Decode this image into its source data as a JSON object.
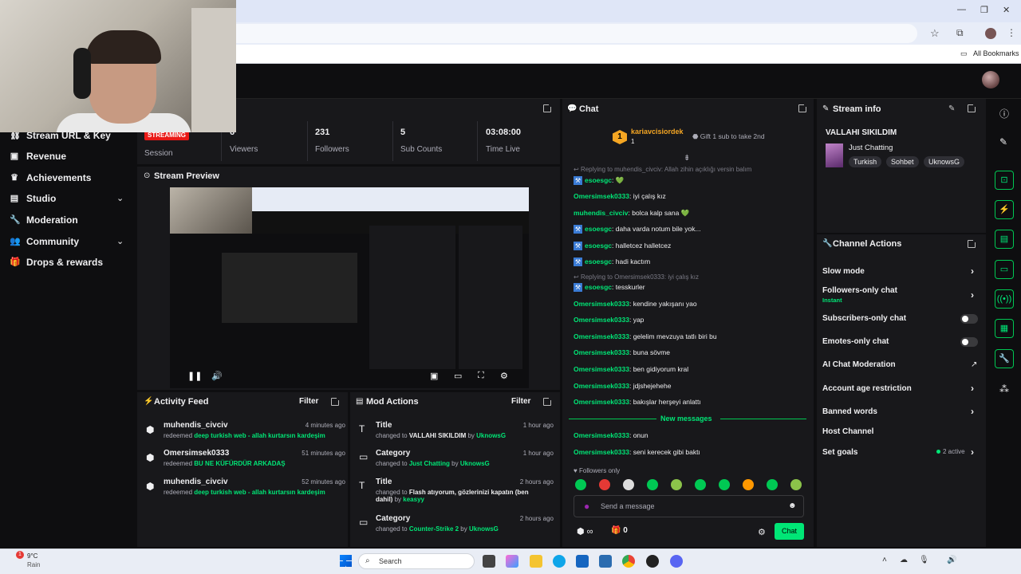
{
  "browser": {
    "bookmarks_label": "All Bookmarks",
    "star_icon": "star-icon",
    "extensions_icon": "puzzle-icon",
    "menu_icon": "kebab-icon"
  },
  "sidebar": {
    "items": [
      {
        "label": "Stream URL & Key",
        "icon": "link-icon"
      },
      {
        "label": "Revenue",
        "icon": "revenue-icon"
      },
      {
        "label": "Achievements",
        "icon": "trophy-icon"
      },
      {
        "label": "Studio",
        "icon": "studio-icon"
      },
      {
        "label": "Moderation",
        "icon": "wrench-icon"
      },
      {
        "label": "Community",
        "icon": "people-icon"
      },
      {
        "label": "Drops & rewards",
        "icon": "gift-icon"
      }
    ]
  },
  "stats": {
    "badge": "STREAMING",
    "session_label": "Session",
    "viewers_value": "6",
    "viewers_label": "Viewers",
    "followers_value": "231",
    "followers_label": "Followers",
    "subs_value": "5",
    "subs_label": "Sub Counts",
    "time_value": "03:08:00",
    "time_label": "Time Live"
  },
  "preview": {
    "title": "Stream Preview"
  },
  "activity": {
    "title": "Activity Feed",
    "filter": "Filter",
    "items": [
      {
        "user": "muhendis_civciv",
        "time": "4 minutes ago",
        "action": "redeemed",
        "reward": "deep turkish web - allah kurtarsın kardeşim"
      },
      {
        "user": "Omersimsek0333",
        "time": "51 minutes ago",
        "action": "redeemed",
        "reward": "BU NE KÜFÜRDÜR ARKADAŞ"
      },
      {
        "user": "muhendis_civciv",
        "time": "52 minutes ago",
        "action": "redeemed",
        "reward": "deep turkish web - allah kurtarsın kardeşim"
      }
    ]
  },
  "mod": {
    "title": "Mod Actions",
    "filter": "Filter",
    "items": [
      {
        "field": "Title",
        "time": "1 hour ago",
        "prefix": "changed to",
        "value": "VALLAHI SIKILDIM",
        "by": "by",
        "user": "UknowsG"
      },
      {
        "field": "Category",
        "time": "1 hour ago",
        "prefix": "changed to",
        "value": "Just Chatting",
        "by": "by",
        "user": "UknowsG"
      },
      {
        "field": "Title",
        "time": "2 hours ago",
        "prefix": "changed to",
        "value": "Flash atıyorum, gözlerinizi kapatın (ben dahil)",
        "by": "by",
        "user": "keasyy"
      },
      {
        "field": "Category",
        "time": "2 hours ago",
        "prefix": "changed to",
        "value": "Counter-Strike 2",
        "by": "by",
        "user": "UknowsG"
      }
    ]
  },
  "chat": {
    "title": "Chat",
    "top_rank": "1",
    "top_user": "kariavcisiordek",
    "top_amount": "1",
    "gift_text": "Gift 1 sub to take 2nd",
    "messages": [
      {
        "reply": "Replying to muhendis_civciv: Allah zihin açıklığı versin balım"
      },
      {
        "badge": true,
        "user": "esoesgc",
        "text": "",
        "emoji": "💚"
      },
      {
        "user": "Omersimsek0333",
        "text": "iyi çalış kız"
      },
      {
        "user": "muhendis_civciv",
        "text": "bolca kalp sana",
        "emoji": "💚"
      },
      {
        "badge": true,
        "user": "esoesgc",
        "text": "daha varda notum bile yok..."
      },
      {
        "badge": true,
        "user": "esoesgc",
        "text": "halletcez halletcez"
      },
      {
        "badge": true,
        "user": "esoesgc",
        "text": "hadi kactım"
      },
      {
        "reply": "Replying to Omersimsek0333: iyi çalış kız"
      },
      {
        "badge": true,
        "user": "esoesgc",
        "text": "tesskurler"
      },
      {
        "user": "Omersimsek0333",
        "text": "kendine yakışanı yao"
      },
      {
        "user": "Omersimsek0333",
        "text": "yap"
      },
      {
        "user": "Omersimsek0333",
        "text": "gelelim mevzuya tatlı biri bu"
      },
      {
        "user": "Omersimsek0333",
        "text": "buna sövme"
      },
      {
        "user": "Omersimsek0333",
        "text": "ben gidiyorum kral"
      },
      {
        "user": "Omersimsek0333",
        "text": "jdjshejehehe"
      },
      {
        "user": "Omersimsek0333",
        "text": "bakışlar herşeyi anlattı"
      }
    ],
    "new_messages": "New messages",
    "after": [
      {
        "user": "Omersimsek0333",
        "text": "onun"
      },
      {
        "user": "Omersimsek0333",
        "text": "seni kerecek gibi baktı"
      }
    ],
    "followers_only": "Followers only",
    "input_placeholder": "Send a message",
    "kick_count": "∞",
    "gift_count": "0",
    "send_label": "Chat"
  },
  "stream_info": {
    "title": "Stream info",
    "stream_title": "VALLAHI SIKILDIM",
    "category": "Just Chatting",
    "tags": [
      "Turkish",
      "Sohbet",
      "UknowsG"
    ]
  },
  "channel_actions": {
    "title": "Channel Actions",
    "slow_mode": "Slow mode",
    "followers_only": "Followers-only chat",
    "followers_only_sub": "Instant",
    "subscribers_only": "Subscribers-only chat",
    "emotes_only": "Emotes-only chat",
    "ai_moderation": "AI Chat Moderation",
    "account_age": "Account age restriction",
    "banned_words": "Banned words",
    "host_channel": "Host Channel",
    "set_goals": "Set goals",
    "goals_active": "2 active"
  },
  "taskbar": {
    "weather_temp": "9°C",
    "weather_desc": "Rain",
    "search": "Search",
    "notification_count": "1"
  },
  "colors": {
    "accent": "#00e676",
    "live": "#e91916",
    "panel": "#18181b",
    "bg": "#0e0e10"
  }
}
